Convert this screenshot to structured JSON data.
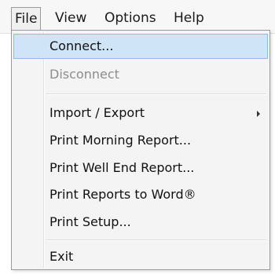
{
  "menubar": {
    "items": [
      "File",
      "View",
      "Options",
      "Help"
    ],
    "active": "File"
  },
  "file_menu": {
    "items": [
      {
        "label": "Connect...",
        "state": "highlighted"
      },
      {
        "label": "Disconnect",
        "state": "disabled"
      },
      {
        "label": "Import / Export",
        "submenu": true
      },
      {
        "label": "Print Morning Report..."
      },
      {
        "label": "Print Well End Report..."
      },
      {
        "label": "Print Reports to Word®"
      },
      {
        "label": "Print Setup..."
      },
      {
        "label": "Exit"
      }
    ]
  },
  "colors": {
    "highlight_fill": "#cfe4f7",
    "highlight_border": "#8fb9e6",
    "disabled_text": "#8d8d8d"
  }
}
